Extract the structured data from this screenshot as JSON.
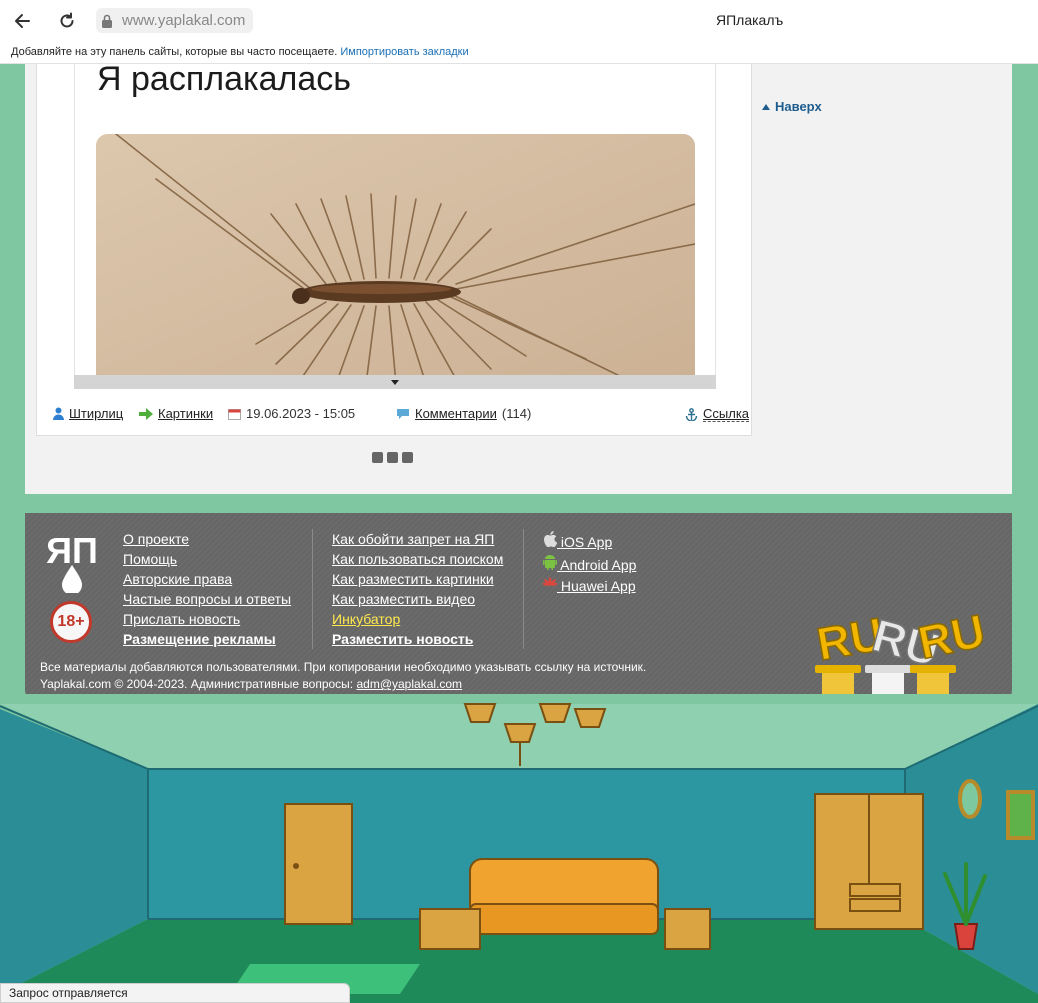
{
  "browser": {
    "url": "www.yaplakal.com",
    "tab_title": "ЯПлакалъ",
    "bookmarks_hint": "Добавляйте на эту панель сайты, которые вы часто посещаете.",
    "bookmarks_import": "Импортировать закладки",
    "status": "Запрос отправляется"
  },
  "post": {
    "headline": "Я расплакалась",
    "meta": {
      "author": "Штирлиц",
      "category": "Картинки",
      "datetime": "19.06.2023 - 15:05",
      "comments_label": "Комментарии",
      "comments_count": "(114)",
      "link_label": "Ссылка"
    }
  },
  "sidebar": {
    "to_top": "Наверх"
  },
  "footer": {
    "col1": [
      "О проекте",
      "Помощь",
      "Авторские права",
      "Частые вопросы и ответы",
      "Прислать новость",
      "Размещение рекламы"
    ],
    "col2": [
      "Как обойти запрет на ЯП",
      "Как пользоваться поиском",
      "Как разместить картинки",
      "Как разместить видео",
      "Инкубатор",
      "Разместить новость"
    ],
    "apps": [
      "iOS App",
      "Android App",
      "Huawei App"
    ],
    "logo_text": "ЯП",
    "age_badge": "18+",
    "note_line1": "Все материалы добавляются пользователями. При копировании необходимо указывать ссылку на источник.",
    "note_line2_prefix": "Yaplakal.com © 2004-2023. Административные вопросы:",
    "email": "adm@yaplakal.com",
    "ruru": "RU"
  },
  "colors": {
    "accent_link": "#1d5c8d",
    "footer_bg": "#676767",
    "highlight": "#ffe94d",
    "scene_wall": "#2f9aa3",
    "scene_floor": "#1f8a59"
  }
}
